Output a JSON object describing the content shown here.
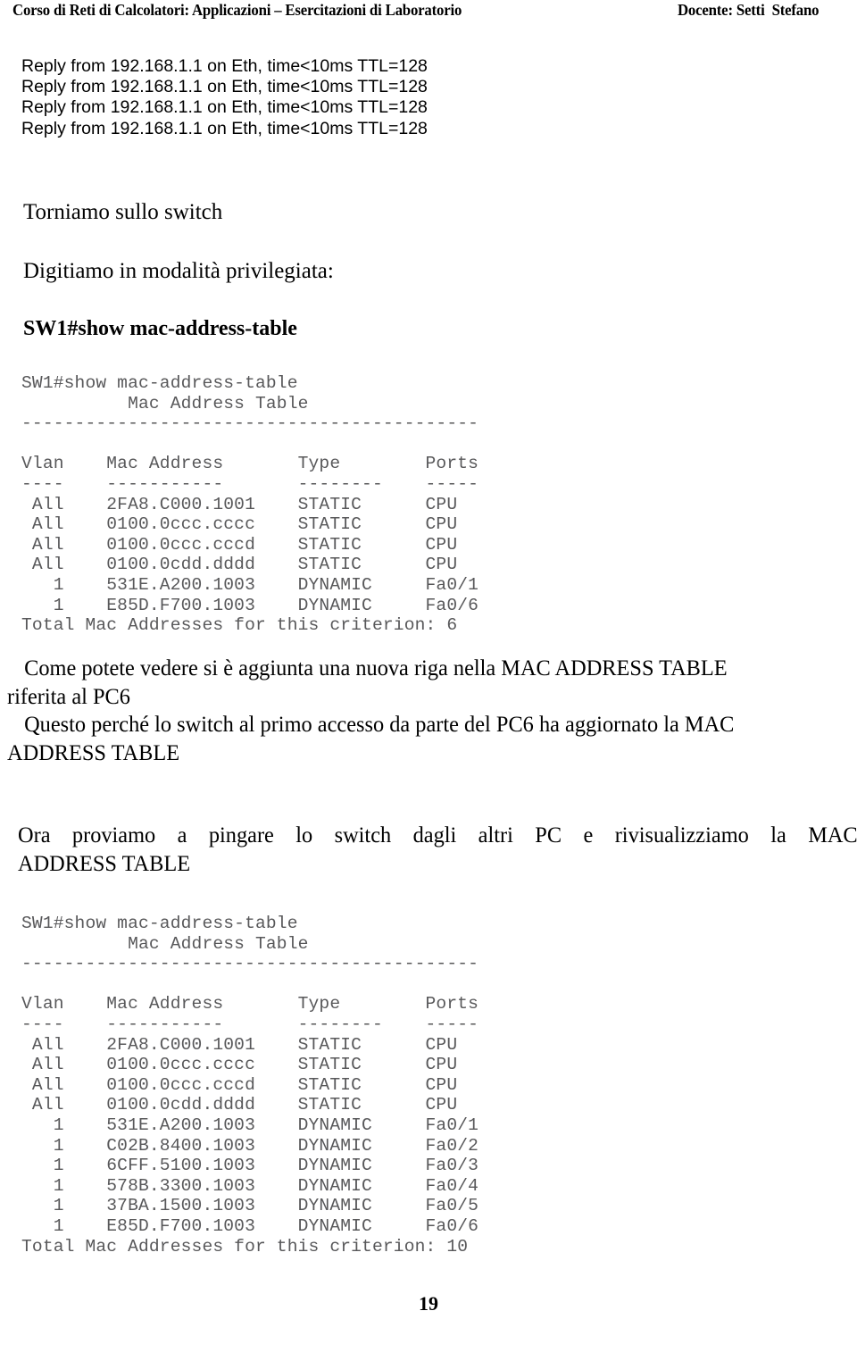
{
  "header": {
    "left": "Corso di Reti di Calcolatori: Applicazioni – Esercitazioni di Laboratorio",
    "right": "Docente: Setti  Stefano"
  },
  "ping_output": {
    "lines": [
      "Reply from 192.168.1.1 on Eth, time<10ms TTL=128",
      "Reply from 192.168.1.1 on Eth, time<10ms TTL=128",
      "Reply from 192.168.1.1 on Eth, time<10ms TTL=128",
      "Reply from 192.168.1.1 on Eth, time<10ms TTL=128"
    ],
    "text": "Reply from 192.168.1.1 on Eth, time<10ms TTL=128\nReply from 192.168.1.1 on Eth, time<10ms TTL=128\nReply from 192.168.1.1 on Eth, time<10ms TTL=128\nReply from 192.168.1.1 on Eth, time<10ms TTL=128"
  },
  "narrative": {
    "torniamo": "Torniamo sullo switch",
    "digitiamo": "Digitiamo in modalità privilegiata:",
    "command_bold": "SW1#show mac-address-table"
  },
  "console_1": {
    "prompt": "SW1#show mac-address-table",
    "title": "Mac Address Table",
    "rule": "-------------------------------------------",
    "columns": [
      "Vlan",
      "Mac Address",
      "Type",
      "Ports"
    ],
    "column_rules": [
      "----",
      "-----------",
      "--------",
      "-----"
    ],
    "rows": [
      {
        "vlan": "All",
        "mac": "2FA8.C000.1001",
        "type": "STATIC",
        "port": "CPU"
      },
      {
        "vlan": "All",
        "mac": "0100.0ccc.cccc",
        "type": "STATIC",
        "port": "CPU"
      },
      {
        "vlan": "All",
        "mac": "0100.0ccc.cccd",
        "type": "STATIC",
        "port": "CPU"
      },
      {
        "vlan": "All",
        "mac": "0100.0cdd.dddd",
        "type": "STATIC",
        "port": "CPU"
      },
      {
        "vlan": "1",
        "mac": "531E.A200.1003",
        "type": "DYNAMIC",
        "port": "Fa0/1"
      },
      {
        "vlan": "1",
        "mac": "E85D.F700.1003",
        "type": "DYNAMIC",
        "port": "Fa0/6"
      }
    ],
    "total_label": "Total Mac Addresses for this criterion:",
    "total_count": "6",
    "text": "SW1#show mac-address-table\n          Mac Address Table\n-------------------------------------------\n\nVlan    Mac Address       Type        Ports\n----    -----------       --------    -----\n All    2FA8.C000.1001    STATIC      CPU\n All    0100.0ccc.cccc    STATIC      CPU\n All    0100.0ccc.cccd    STATIC      CPU\n All    0100.0cdd.dddd    STATIC      CPU\n   1    531E.A200.1003    DYNAMIC     Fa0/1\n   1    E85D.F700.1003    DYNAMIC     Fa0/6\nTotal Mac Addresses for this criterion: 6"
  },
  "explain_1": {
    "line_1": "Come potete vedere si è aggiunta una nuova riga nella MAC ADDRESS TABLE",
    "line_2": "riferita al PC6",
    "line_3": "Questo perché lo switch al primo accesso da parte del PC6 ha aggiornato la MAC",
    "line_4": "ADDRESS TABLE"
  },
  "explain_2": {
    "line_1": "Ora proviamo a pingare lo switch dagli altri PC e rivisualizziamo la MAC",
    "line_2": "ADDRESS TABLE"
  },
  "console_2": {
    "prompt": "SW1#show mac-address-table",
    "title": "Mac Address Table",
    "rule": "-------------------------------------------",
    "columns": [
      "Vlan",
      "Mac Address",
      "Type",
      "Ports"
    ],
    "column_rules": [
      "----",
      "-----------",
      "--------",
      "-----"
    ],
    "rows": [
      {
        "vlan": "All",
        "mac": "2FA8.C000.1001",
        "type": "STATIC",
        "port": "CPU"
      },
      {
        "vlan": "All",
        "mac": "0100.0ccc.cccc",
        "type": "STATIC",
        "port": "CPU"
      },
      {
        "vlan": "All",
        "mac": "0100.0ccc.cccd",
        "type": "STATIC",
        "port": "CPU"
      },
      {
        "vlan": "All",
        "mac": "0100.0cdd.dddd",
        "type": "STATIC",
        "port": "CPU"
      },
      {
        "vlan": "1",
        "mac": "531E.A200.1003",
        "type": "DYNAMIC",
        "port": "Fa0/1"
      },
      {
        "vlan": "1",
        "mac": "C02B.8400.1003",
        "type": "DYNAMIC",
        "port": "Fa0/2"
      },
      {
        "vlan": "1",
        "mac": "6CFF.5100.1003",
        "type": "DYNAMIC",
        "port": "Fa0/3"
      },
      {
        "vlan": "1",
        "mac": "578B.3300.1003",
        "type": "DYNAMIC",
        "port": "Fa0/4"
      },
      {
        "vlan": "1",
        "mac": "37BA.1500.1003",
        "type": "DYNAMIC",
        "port": "Fa0/5"
      },
      {
        "vlan": "1",
        "mac": "E85D.F700.1003",
        "type": "DYNAMIC",
        "port": "Fa0/6"
      }
    ],
    "total_label": "Total Mac Addresses for this criterion:",
    "total_count": "10",
    "text": "SW1#show mac-address-table\n          Mac Address Table\n-------------------------------------------\n\nVlan    Mac Address       Type        Ports\n----    -----------       --------    -----\n All    2FA8.C000.1001    STATIC      CPU\n All    0100.0ccc.cccc    STATIC      CPU\n All    0100.0ccc.cccd    STATIC      CPU\n All    0100.0cdd.dddd    STATIC      CPU\n   1    531E.A200.1003    DYNAMIC     Fa0/1\n   1    C02B.8400.1003    DYNAMIC     Fa0/2\n   1    6CFF.5100.1003    DYNAMIC     Fa0/3\n   1    578B.3300.1003    DYNAMIC     Fa0/4\n   1    37BA.1500.1003    DYNAMIC     Fa0/5\n   1    E85D.F700.1003    DYNAMIC     Fa0/6\nTotal Mac Addresses for this criterion: 10"
  },
  "footer": {
    "page_number": "19"
  }
}
